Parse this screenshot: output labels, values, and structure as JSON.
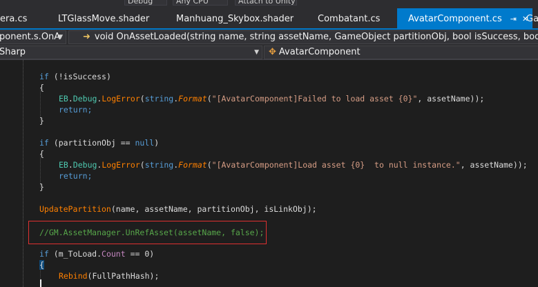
{
  "toolbar": {
    "items": [
      "Debug",
      "Any CPU",
      "Attach to Unity"
    ]
  },
  "tabs": [
    {
      "label": "era.cs"
    },
    {
      "label": "LTGlassMove.shader"
    },
    {
      "label": "Manhuang_Skybox.shader"
    },
    {
      "label": "Combatant.cs"
    },
    {
      "label": "AvatarComponent.cs",
      "active": true
    },
    {
      "label": "Ga"
    }
  ],
  "tab_icons": {
    "pin": "pin-icon",
    "close": "close-icon"
  },
  "nav": {
    "member_dropdown": "ponent.s.OnA",
    "method_signature": "void OnAssetLoaded(string name, string assetName, GameObject partitionObj, bool isSuccess, bool isLinkObj)",
    "project_dropdown": "Sharp",
    "class_dropdown": "AvatarComponent"
  },
  "code": {
    "l1": "if (!isSuccess)",
    "open": "{",
    "close": "}",
    "eb": "EB",
    "debug": "Debug",
    "logerror": "LogError",
    "string_kw": "string",
    "format": "Format",
    "str_failed": "\"[AvatarComponent]Failed to load asset {0}\"",
    "args_failed": ", assetName));",
    "ret": "return;",
    "l_if2_kw": "if",
    "l_if2_rest": " (partitionObj == ",
    "null_kw": "null",
    "paren_close": ")",
    "str_null": "\"[AvatarComponent]Load asset {0}  to null instance.\"",
    "args_null": ", assetName));",
    "update_fn": "UpdatePartition",
    "update_args": "(name, assetName, partitionObj, isLinkObj);",
    "comment": "//GM.AssetManager.UnRefAsset(assetName, false);",
    "if3_rest1": " (m_ToLoad.",
    "count_prop": "Count",
    "if3_rest2": " == 0)",
    "rebind_fn": "Rebind",
    "rebind_args": "(FullPathHash);"
  },
  "colors": {
    "accent": "#007acc",
    "highlight_box": "#e03030",
    "keyword": "#569cd6",
    "string": "#d69d85",
    "comment": "#57a64a"
  }
}
